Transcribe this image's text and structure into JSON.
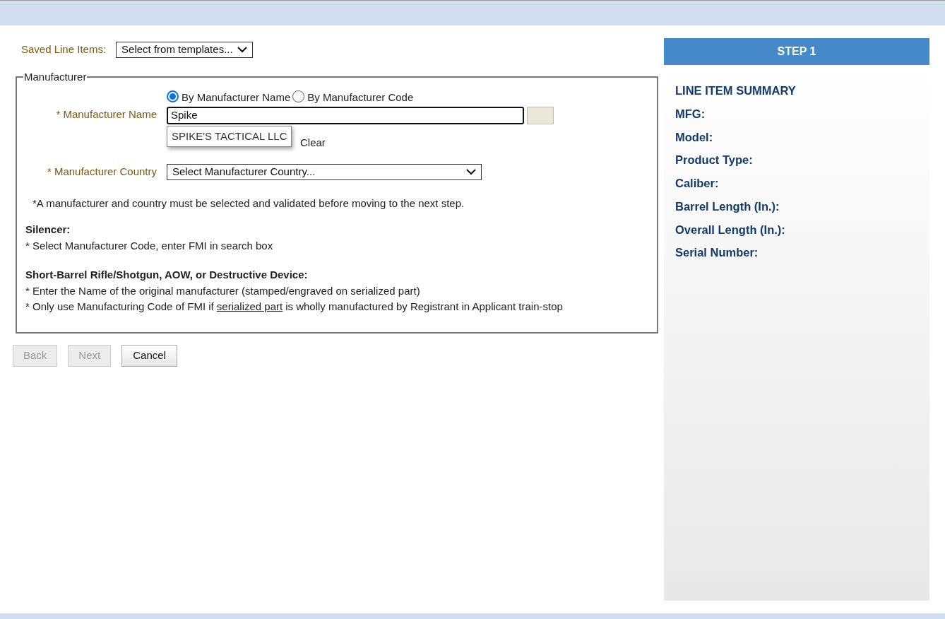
{
  "saved_line_items": {
    "label": "Saved Line Items:",
    "value": "Select from templates..."
  },
  "manufacturer": {
    "legend": "Manufacturer",
    "search_by": [
      {
        "label": "By Manufacturer Name",
        "selected": true
      },
      {
        "label": "By Manufacturer Code",
        "selected": false
      }
    ],
    "name_label": "* Manufacturer Name",
    "name_value": "Spike",
    "suggestion": "SPIKE'S TACTICAL LLC",
    "clear": "Clear",
    "country_label": "* Manufacturer Country",
    "country_value": "Select Manufacturer Country...",
    "notice": "*A manufacturer and country must be selected and validated before moving to the next step.",
    "silencer_title": "Silencer:",
    "silencer_note": "* Select Manufacturer Code, enter FMI in search box",
    "sbr_title": "Short-Barrel Rifle/Shotgun, AOW, or Destructive Device:",
    "sbr_note_1": "* Enter the Name of the original manufacturer (stamped/engraved on serialized part)",
    "sbr_note_2": {
      "before": "* Only use Manufacturing Code of FMI if",
      "link": "serialized part",
      "after": "is wholly manufactured by Registrant in Applicant train-stop"
    }
  },
  "buttons": [
    {
      "label": "Back",
      "disabled": true
    },
    {
      "label": "Next",
      "disabled": true
    },
    {
      "label": "Cancel",
      "disabled": false
    }
  ],
  "sidebar": {
    "step": "STEP 1",
    "title": "LINE ITEM SUMMARY",
    "items": [
      "MFG:",
      "Model:",
      "Product Type:",
      "Caliber:",
      "Barrel Length (In.):",
      "Overall Length (In.):",
      "Serial Number:"
    ]
  }
}
